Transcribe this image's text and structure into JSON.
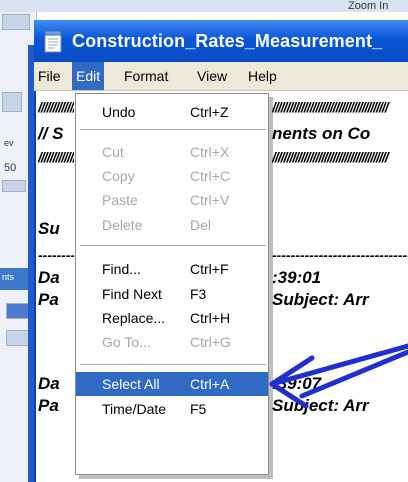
{
  "window": {
    "title": "Construction_Rates_Measurement_"
  },
  "menubar": {
    "items": [
      {
        "label": "File"
      },
      {
        "label": "Edit"
      },
      {
        "label": "Format"
      },
      {
        "label": "View"
      },
      {
        "label": "Help"
      }
    ],
    "active": "Edit"
  },
  "edit_menu": {
    "items": [
      {
        "label": "Undo",
        "shortcut": "Ctrl+Z",
        "enabled": true
      },
      {
        "label": "Cut",
        "shortcut": "Ctrl+X",
        "enabled": false
      },
      {
        "label": "Copy",
        "shortcut": "Ctrl+C",
        "enabled": false
      },
      {
        "label": "Paste",
        "shortcut": "Ctrl+V",
        "enabled": false
      },
      {
        "label": "Delete",
        "shortcut": "Del",
        "enabled": false
      },
      {
        "label": "Find...",
        "shortcut": "Ctrl+F",
        "enabled": true
      },
      {
        "label": "Find Next",
        "shortcut": "F3",
        "enabled": true
      },
      {
        "label": "Replace...",
        "shortcut": "Ctrl+H",
        "enabled": true
      },
      {
        "label": "Go To...",
        "shortcut": "Ctrl+G",
        "enabled": false
      },
      {
        "label": "Select All",
        "shortcut": "Ctrl+A",
        "enabled": true,
        "highlighted": true
      },
      {
        "label": "Time/Date",
        "shortcut": "F5",
        "enabled": true
      }
    ]
  },
  "document": {
    "slashes_1": "////////////////////////////////////////",
    "line_2_left": "// S",
    "line_2_right": "nents on Co",
    "slashes_3": "////////////////////////////////////////",
    "line_4": "Su",
    "dashes": "----------------------------------------",
    "date_1_left": "Da",
    "date_1_right": ":39:01",
    "page_1_left": "Pa",
    "page_1_right": "Subject: Arr",
    "date_2_left": "Da",
    "date_2_right": ":39:07",
    "page_2_left": "Pa",
    "page_2_right": "Subject: Arr"
  },
  "background": {
    "left_labels": [
      "ev",
      "50",
      "nts"
    ],
    "top_right_text": "Zoom In"
  },
  "colors": {
    "titlebar": "#0b55d6",
    "menu_highlight": "#316ac5",
    "annotation_arrow": "#1f2fd0",
    "disabled_text": "#a7a7a7"
  },
  "icons": [
    "notepad-icon"
  ]
}
